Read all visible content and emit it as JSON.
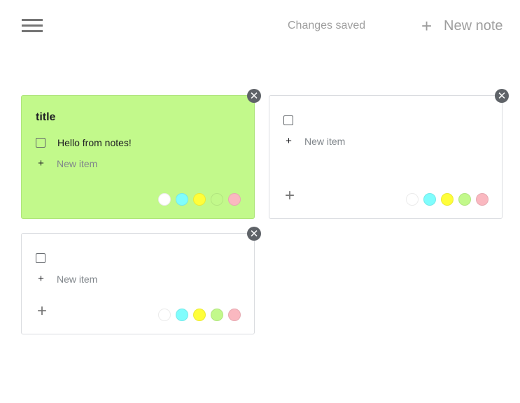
{
  "header": {
    "menu_icon": "menu-icon",
    "status": "Changes saved",
    "new_note_label": "New note",
    "new_note_icon": "+"
  },
  "palette": [
    "#ffffff",
    "#7ffdfd",
    "#fffe3a",
    "#c2f98b",
    "#fab8c0"
  ],
  "notes": [
    {
      "title": "title",
      "color": "#c2f98b",
      "items": [
        "Hello from notes!"
      ],
      "add_item_placeholder": "New item",
      "close_icon": "✕"
    },
    {
      "title": "",
      "color": "#ffffff",
      "items": [
        ""
      ],
      "add_item_placeholder": "New item",
      "close_icon": "✕",
      "add_icon": "+"
    },
    {
      "title": "",
      "color": "#ffffff",
      "items": [
        ""
      ],
      "add_item_placeholder": "New item",
      "close_icon": "✕",
      "add_icon": "+"
    }
  ]
}
